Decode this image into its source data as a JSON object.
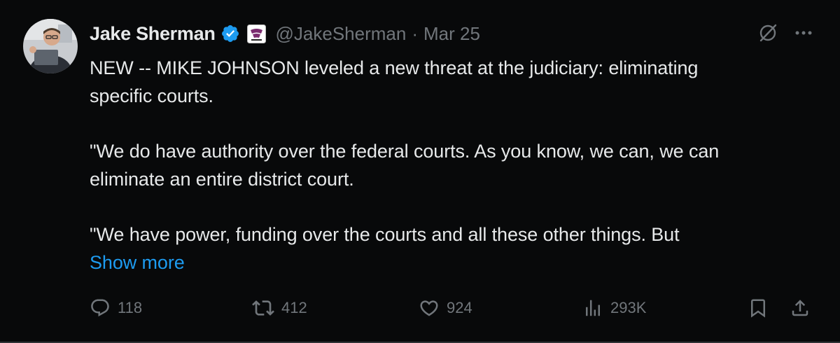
{
  "tweet": {
    "author": {
      "display_name": "Jake Sherman",
      "handle": "@JakeSherman",
      "verified": true
    },
    "separator": "·",
    "date": "Mar 25",
    "text": {
      "p1_line1": "NEW -- MIKE JOHNSON leveled a new threat at the judiciary: eliminating",
      "p1_line2": "specific courts.",
      "p2_line1": "\"We do have authority over the federal courts. As you know, we can, we can",
      "p2_line2": "eliminate an entire district court.",
      "p3_line1": "\"We have power, funding over the courts and all these other things. But"
    },
    "show_more": "Show more",
    "stats": {
      "replies": "118",
      "reposts": "412",
      "likes": "924",
      "views": "293K"
    }
  },
  "colors": {
    "background": "#08090a",
    "text": "#e7e9ea",
    "muted": "#71767b",
    "link": "#1d9bf0",
    "verified": "#1d9bf0"
  },
  "icons": [
    "avatar",
    "verified-badge-icon",
    "affiliate-badge-icon",
    "grok-icon",
    "more-icon",
    "reply-icon",
    "repost-icon",
    "like-icon",
    "views-icon",
    "bookmark-icon",
    "share-icon"
  ]
}
